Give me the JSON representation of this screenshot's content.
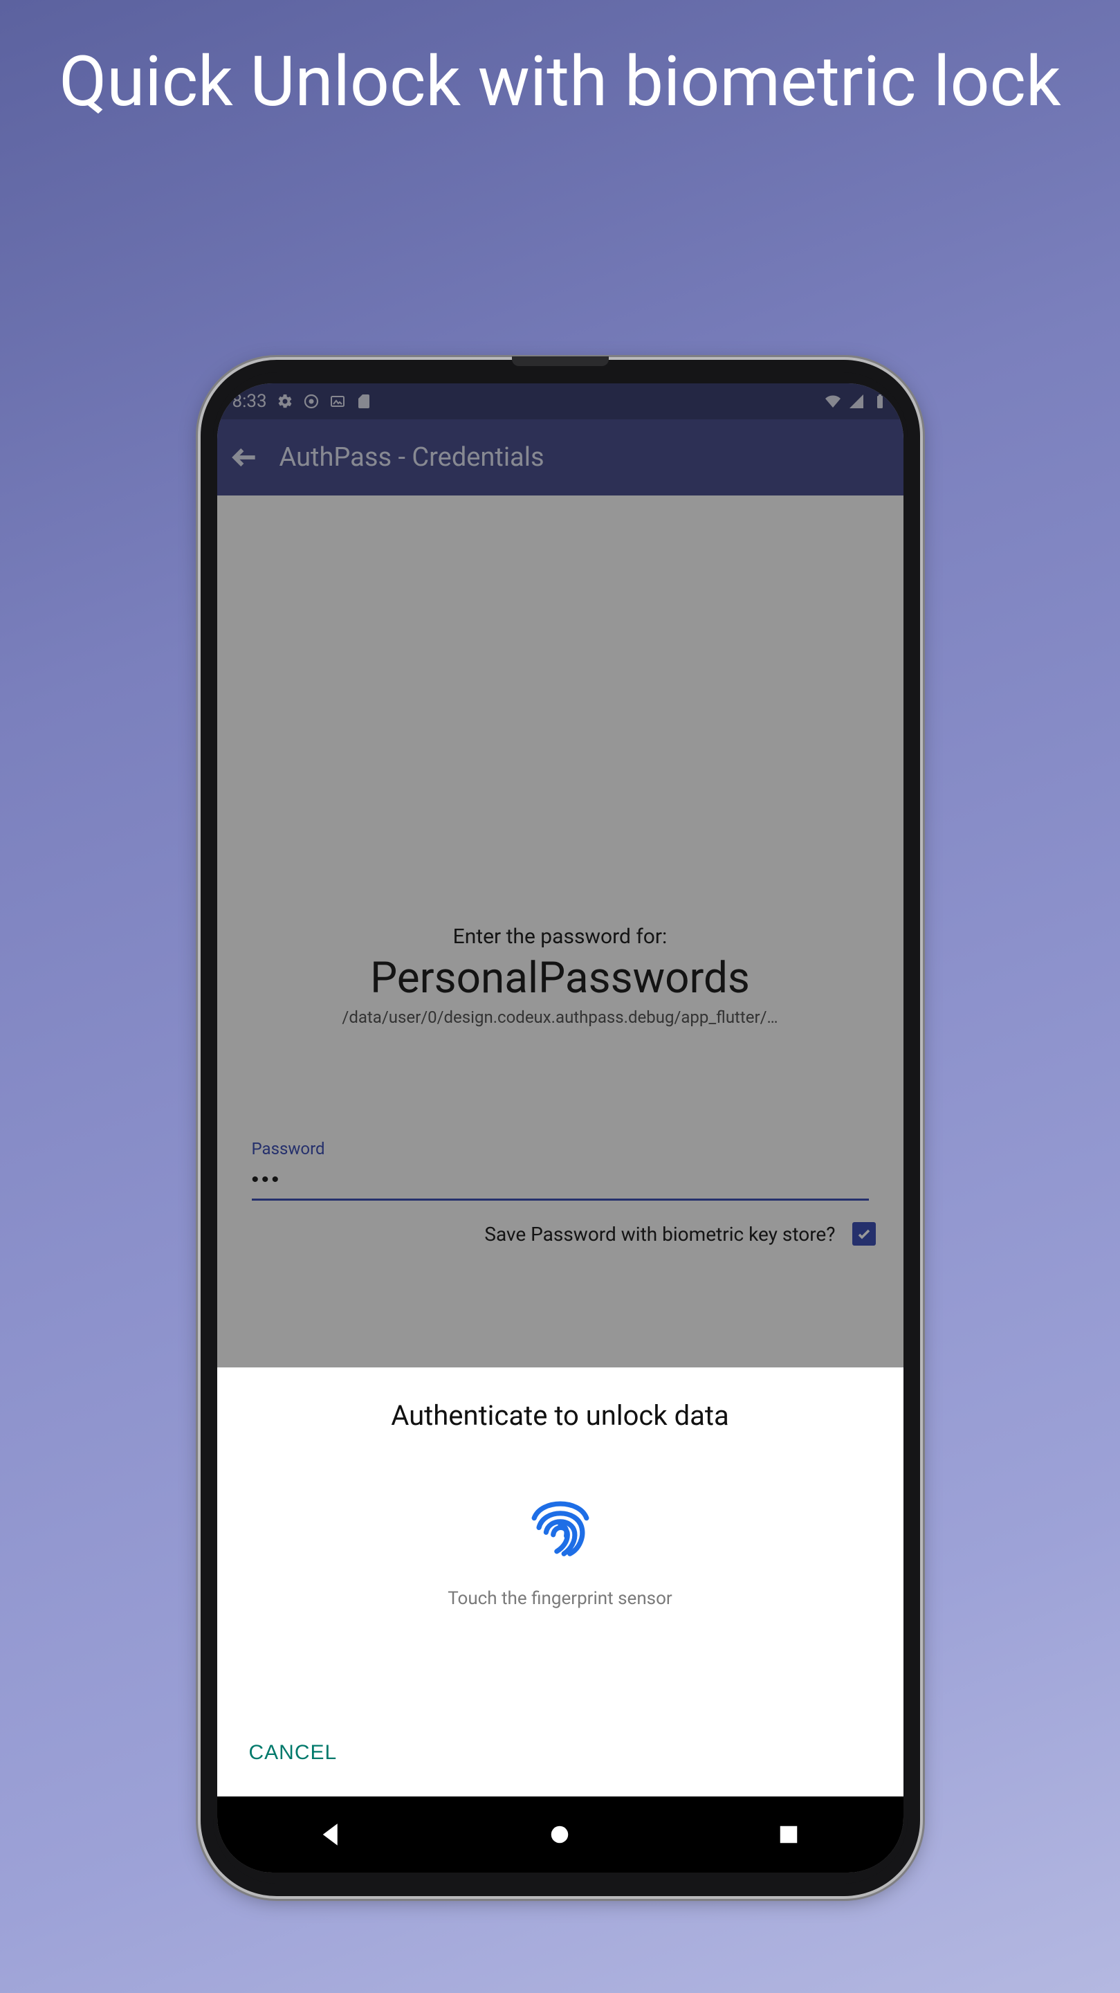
{
  "headline": "Quick Unlock with biometric lock",
  "statusbar": {
    "time": "8:33"
  },
  "appbar": {
    "title": "AuthPass - Credentials"
  },
  "credentials": {
    "enter_for": "Enter the password for:",
    "db_name": "PersonalPasswords",
    "db_path": "/data/user/0/design.codeux.authpass.debug/app_flutter/…",
    "password_label": "Password",
    "password_value": "•••",
    "save_biometric_label": "Save Password with biometric key store?",
    "save_biometric_checked": true
  },
  "sheet": {
    "title": "Authenticate to unlock data",
    "hint": "Touch the fingerprint sensor",
    "cancel": "CANCEL"
  },
  "colors": {
    "primary": "#3f51b5",
    "teal": "#00796b",
    "appbar": "#4c518e",
    "statusbar": "#3d4172"
  }
}
